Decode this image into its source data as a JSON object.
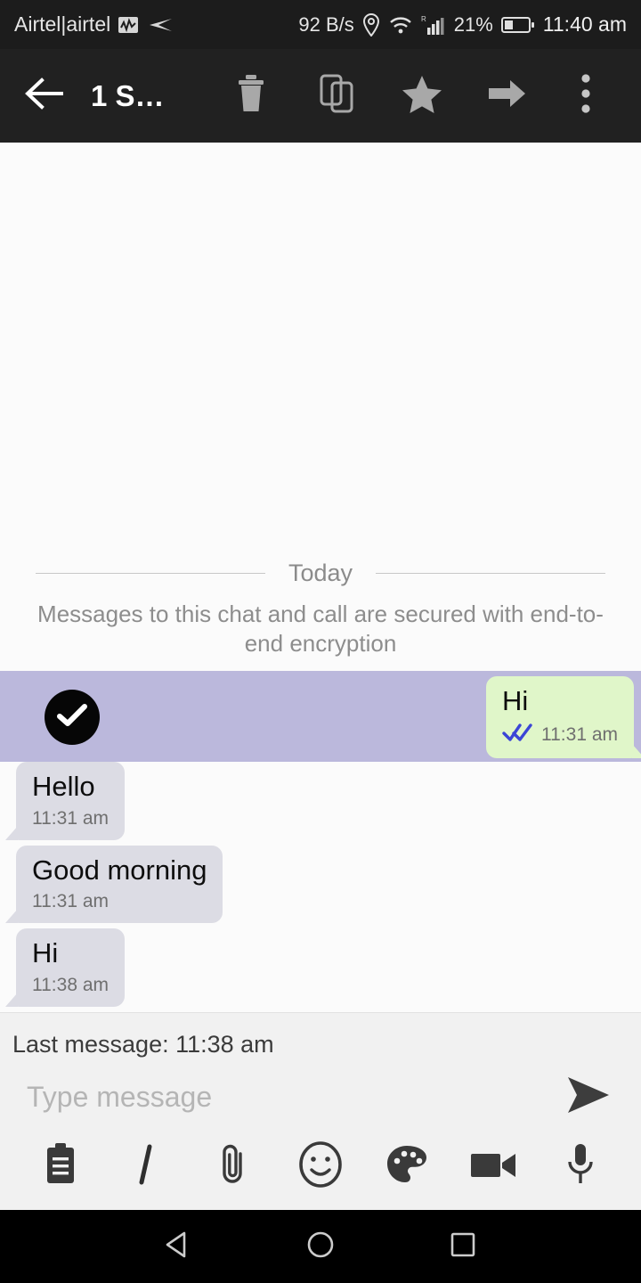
{
  "status_bar": {
    "carrier": "Airtel|airtel",
    "network_activity_icon": "signal-activity-icon",
    "data_arrow_icon": "data-transfer-icon",
    "net_speed": "92 B/s",
    "location_icon": "location-pin-icon",
    "wifi_icon": "wifi-hotspot-icon",
    "signal_icon": "cellular-signal-icon",
    "signal_roaming_label": "R",
    "battery_percent": "21%",
    "battery_icon": "battery-low-icon",
    "clock": "11:40 am"
  },
  "toolbar": {
    "back_icon": "back-arrow-icon",
    "title": "1 S…",
    "actions": [
      {
        "name": "delete-button",
        "icon": "trash-icon",
        "label": "Delete"
      },
      {
        "name": "copy-button",
        "icon": "copy-icon",
        "label": "Copy"
      },
      {
        "name": "star-button",
        "icon": "star-icon",
        "label": "Star"
      },
      {
        "name": "forward-button",
        "icon": "forward-arrow-icon",
        "label": "Forward"
      },
      {
        "name": "more-options-button",
        "icon": "more-vertical-icon",
        "label": "More options"
      }
    ]
  },
  "chat": {
    "day_divider_label": "Today",
    "encryption_notice": "Messages to this chat and call are secured with end-to-end encryption",
    "messages": [
      {
        "text": "Hi",
        "time": "11:31 am",
        "direction": "out",
        "selected": true,
        "status_icon": "double-check-read-icon"
      },
      {
        "text": "Hello",
        "time": "11:31 am",
        "direction": "in",
        "selected": false
      },
      {
        "text": "Good morning",
        "time": "11:31 am",
        "direction": "in",
        "selected": false
      },
      {
        "text": "Hi",
        "time": "11:38 am",
        "direction": "in",
        "selected": false
      }
    ]
  },
  "composer": {
    "last_message_status": "Last message: 11:38 am",
    "input_value": "",
    "input_placeholder": "Type message",
    "send_icon": "send-icon",
    "attachments": [
      {
        "name": "notes-button",
        "icon": "clipboard-icon",
        "label": "Notes"
      },
      {
        "name": "italic-button",
        "icon": "italic-icon",
        "label": "I"
      },
      {
        "name": "attach-file-button",
        "icon": "paperclip-icon",
        "label": "Attach"
      },
      {
        "name": "emoji-button",
        "icon": "smiley-icon",
        "label": "Emoji"
      },
      {
        "name": "palette-button",
        "icon": "palette-icon",
        "label": "Theme"
      },
      {
        "name": "video-button",
        "icon": "video-camera-icon",
        "label": "Video"
      },
      {
        "name": "mic-button",
        "icon": "microphone-icon",
        "label": "Voice"
      }
    ]
  },
  "nav_bar": {
    "back": "nav-back-icon",
    "home": "nav-home-icon",
    "recents": "nav-recents-icon"
  },
  "colors": {
    "toolbar_bg": "#212121",
    "status_bg": "#1c1c1c",
    "chat_bg": "#fbfbfb",
    "selection_highlight": "#bbb8dc",
    "outgoing_bubble": "#e0f6c9",
    "incoming_bubble": "#dcdce4",
    "composer_bg": "#f1f1f1",
    "read_tick": "#3b45d6"
  }
}
